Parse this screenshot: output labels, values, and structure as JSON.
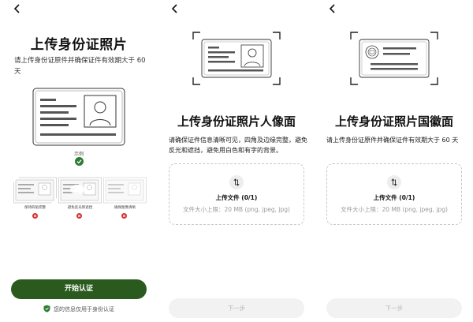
{
  "panel1": {
    "title": "上传身份证照片",
    "subtitle": "请上传身份证原件并确保证件有效期大于 60 天",
    "sample_label": "示例",
    "bad_examples": [
      {
        "label": "保持四角完整",
        "icon": "cropped-card-icon"
      },
      {
        "label": "避免反光和遮挡",
        "icon": "glare-card-icon"
      },
      {
        "label": "确保图像清晰",
        "icon": "blurry-card-icon"
      }
    ],
    "start_button": "开始认证",
    "privacy_note": "您的信息仅用于身份认证"
  },
  "panel2": {
    "title": "上传身份证照片人像面",
    "subtitle": "请确保证件信息清晰可见，四角及边缘完整，避免反光和遮挡，避免用白色和有字的背景。",
    "upload_title": "上传文件 (0/1)",
    "upload_hint": "文件大小上限：20 MB (png, jpeg, jpg)",
    "next_button": "下一步"
  },
  "panel3": {
    "title": "上传身份证照片国徽面",
    "subtitle": "请上传身份证原件并确保证件有效期大于 60 天",
    "upload_title": "上传文件 (0/1)",
    "upload_hint": "文件大小上限：20 MB (png, jpeg, jpg)",
    "next_button": "下一步"
  },
  "colors": {
    "primary": "#2b5a1e",
    "success": "#2e7d32",
    "error": "#d32f2f",
    "disabled_bg": "#f2f2f2",
    "disabled_text": "#b9b9b9"
  }
}
